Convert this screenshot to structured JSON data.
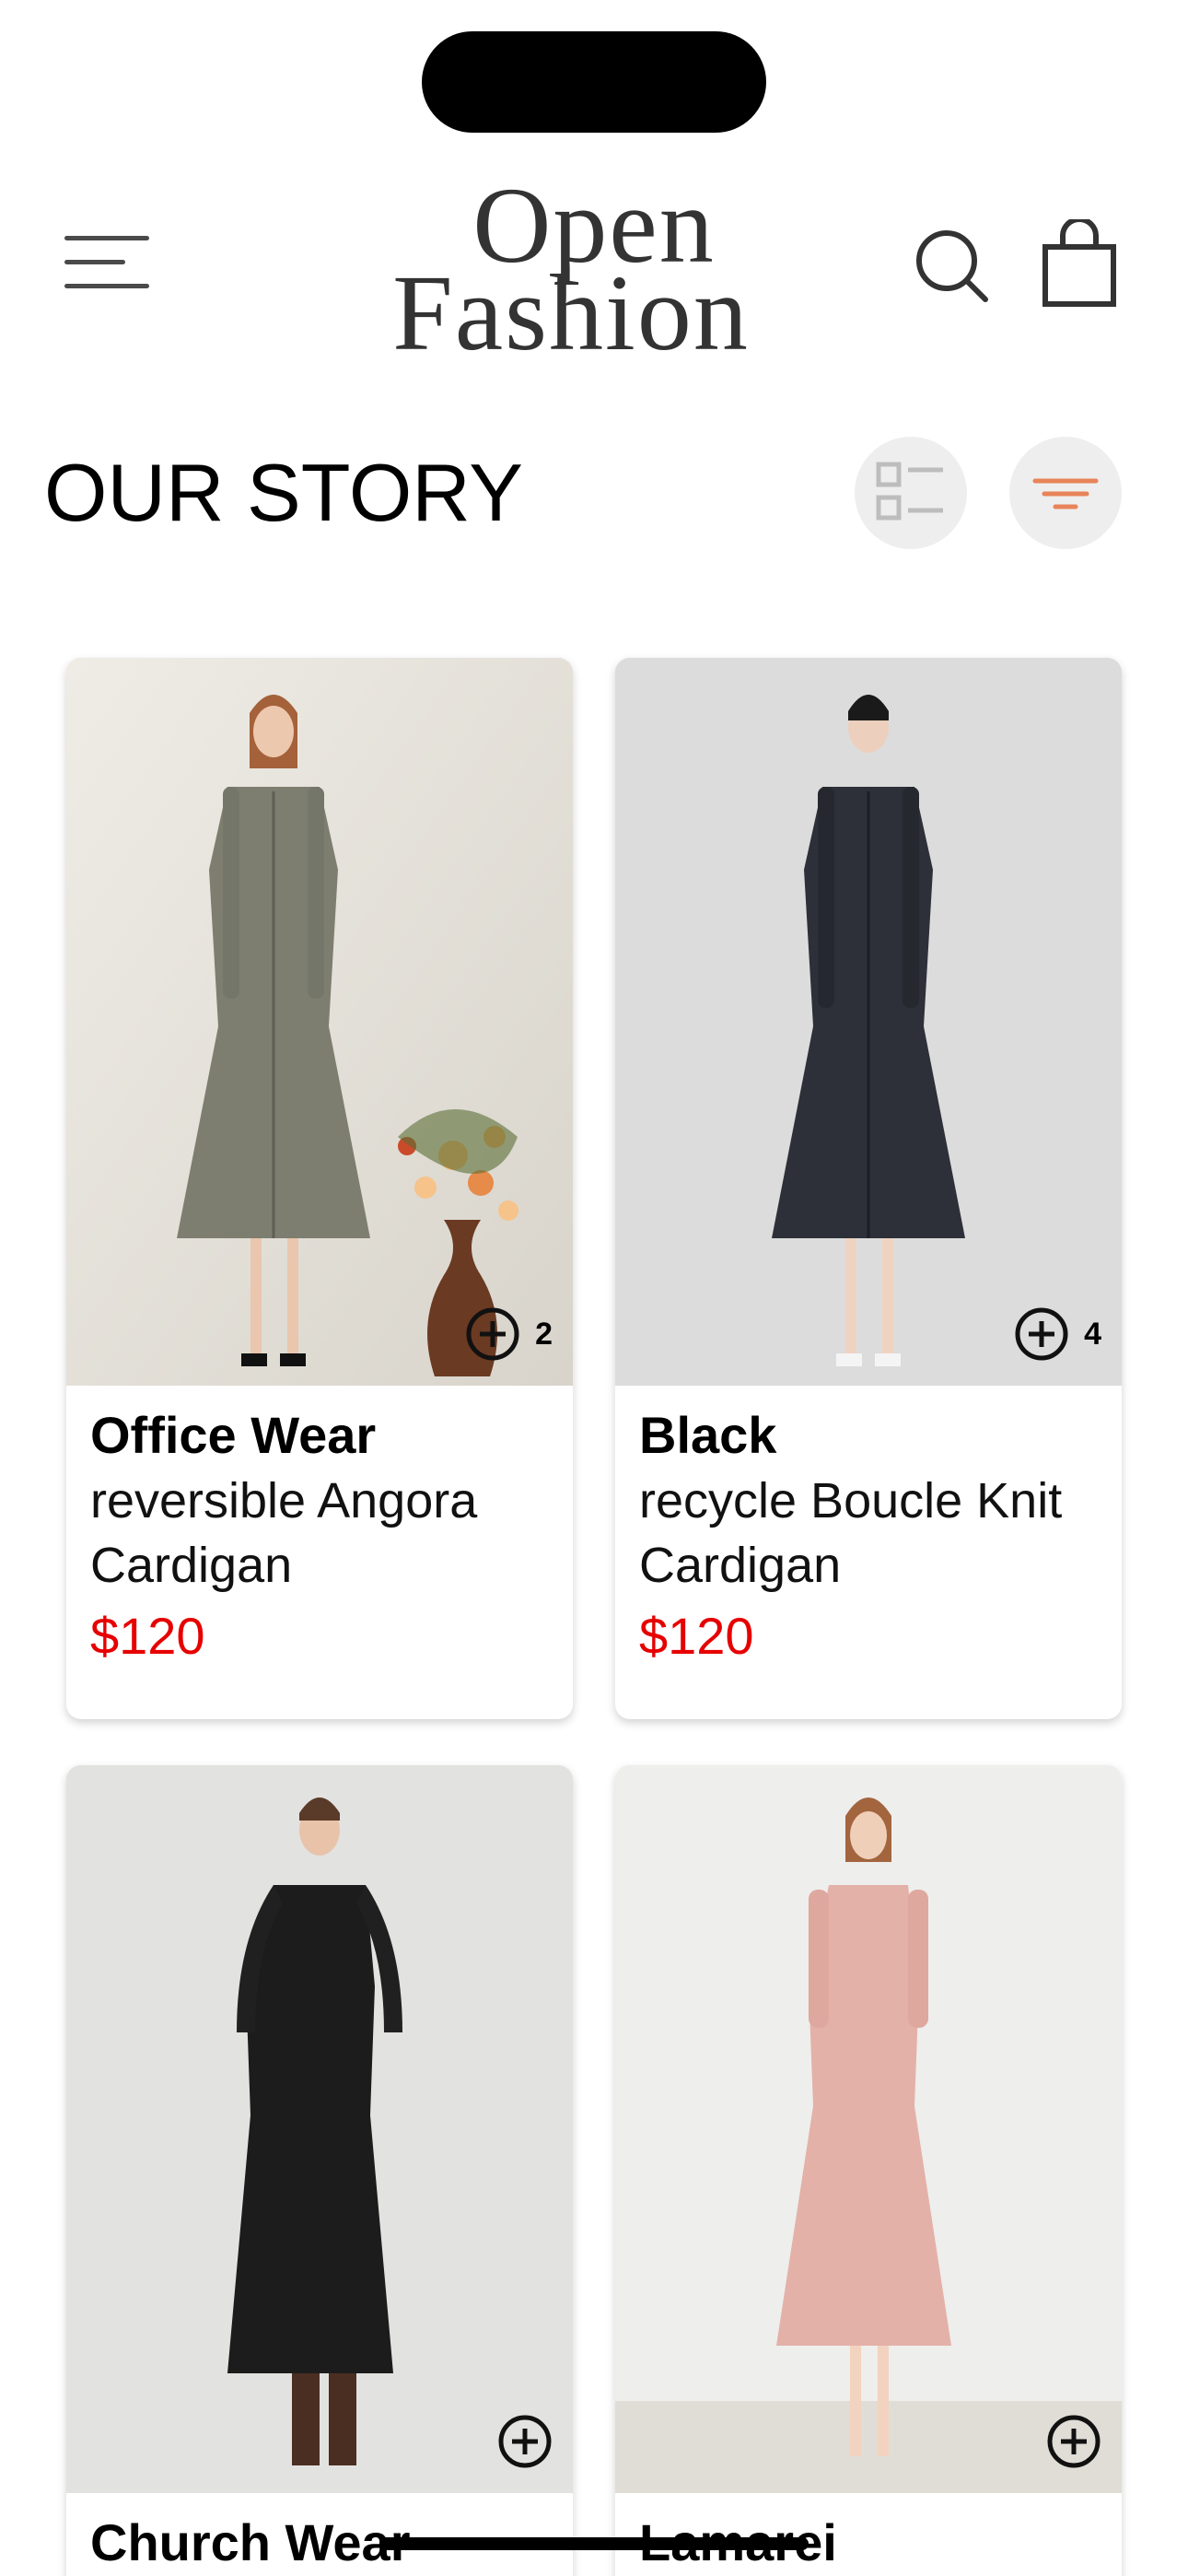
{
  "header": {
    "logo_line1": "Open",
    "logo_line2": "Fashion",
    "menu_icon": "hamburger-menu-icon",
    "search_icon": "search-icon",
    "cart_icon": "shopping-bag-icon"
  },
  "page": {
    "title": "OUR STORY",
    "view_toggle_icon": "list-view-icon",
    "filter_icon": "filter-icon",
    "filter_icon_color": "#e8845a"
  },
  "products": [
    {
      "brand": "Office Wear",
      "name": "reversible Angora Cardigan",
      "price": "$120",
      "count": "2",
      "bg": "#e6e3dc",
      "dress": "#7d7e70"
    },
    {
      "brand": "Black",
      "name": "recycle Boucle Knit Cardigan",
      "price": "$120",
      "count": "4",
      "bg": "#dedede",
      "dress": "#2d3038"
    },
    {
      "brand": "Church Wear",
      "name": "",
      "price": "",
      "count": "",
      "bg": "#e4e4e2",
      "dress": "#1c1c1c"
    },
    {
      "brand": "Lamarei",
      "name": "",
      "price": "",
      "count": "",
      "bg": "#ececeb",
      "dress": "#e3b1a8"
    }
  ],
  "colors": {
    "price": "#e60000",
    "icon_bg": "#eeeeee"
  }
}
